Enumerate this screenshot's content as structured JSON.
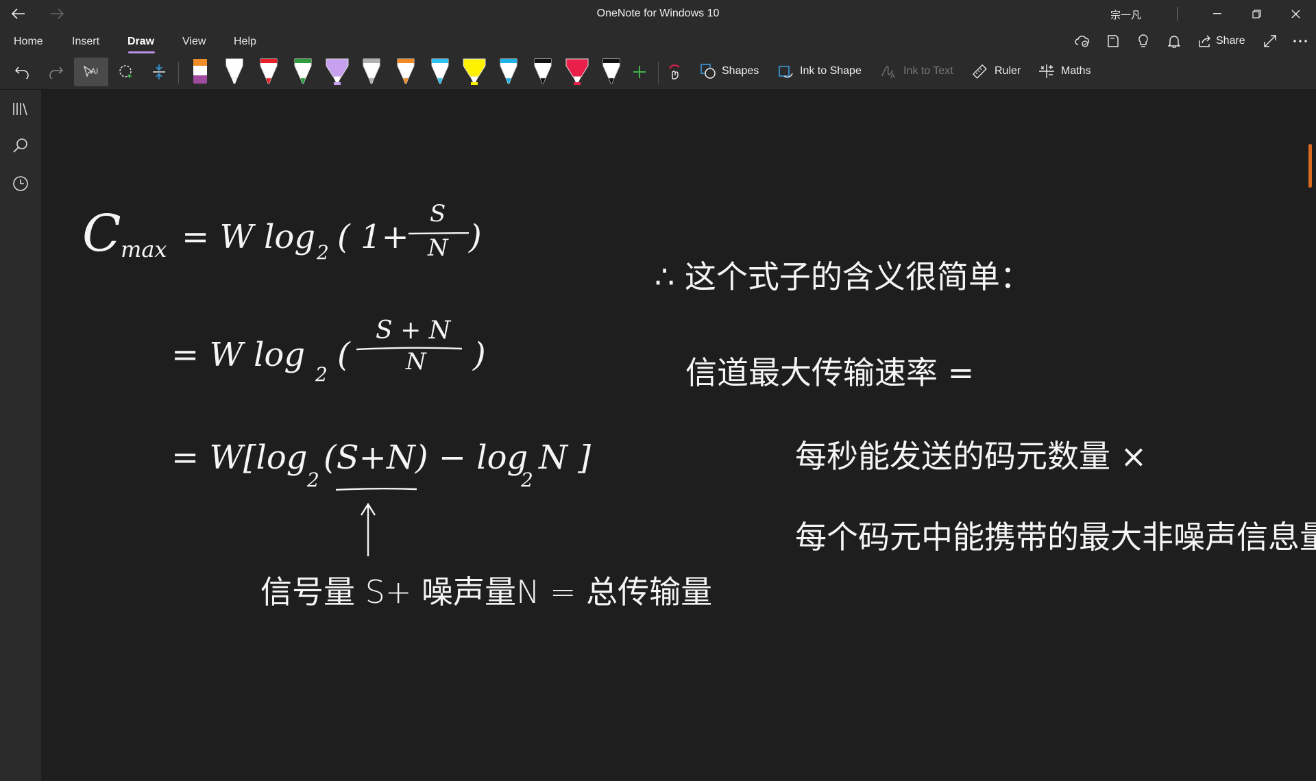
{
  "window": {
    "title": "OneNote for Windows 10",
    "user": "宗一凡"
  },
  "ribbon": {
    "tabs": [
      "Home",
      "Insert",
      "Draw",
      "View",
      "Help"
    ],
    "active_tab": "Draw",
    "share_label": "Share"
  },
  "toolbar": {
    "shapes_label": "Shapes",
    "ink_to_shape_label": "Ink to Shape",
    "ink_to_text_label": "Ink to Text",
    "ruler_label": "Ruler",
    "maths_label": "Maths",
    "pens": [
      {
        "type": "marker",
        "color": "#f28c28",
        "body": "#a04aa0"
      },
      {
        "type": "pen",
        "color": "#ffffff"
      },
      {
        "type": "pen",
        "color": "#e8202a"
      },
      {
        "type": "pen",
        "color": "#2e9d3e"
      },
      {
        "type": "highlighter",
        "color": "#c8a0f0"
      },
      {
        "type": "pen",
        "color": "#b0b0b0"
      },
      {
        "type": "pen",
        "color": "#f08a24"
      },
      {
        "type": "pen",
        "color": "#2ec0f0"
      },
      {
        "type": "highlighter",
        "color": "#fff200"
      },
      {
        "type": "pen",
        "color": "#1eb4e6"
      },
      {
        "type": "pen",
        "color": "#111111"
      },
      {
        "type": "highlighter",
        "color": "#e8204a"
      },
      {
        "type": "pen",
        "color": "#111111"
      }
    ],
    "accent_green": "#3cb44b"
  },
  "canvas": {
    "ink": {
      "line1_lhs": "C",
      "line1_sub": "max",
      "line1_eq": "= W log",
      "line1_sub2": "2",
      "line1_rest": "( 1+",
      "frac1_num": "S",
      "frac1_den": "N",
      "line1_close": ")",
      "line2_eq": "= W log",
      "line2_sub": "2",
      "line2_open": "(",
      "frac2_num": "S + N",
      "frac2_den": "N",
      "line2_close": ")",
      "line3_eq": "= W[log",
      "line3_sub": "2",
      "line3_mid": "(S+N) − log",
      "line3_sub2": "2",
      "line3_end": "N ]",
      "arrow_note": "信号量 S+ 噪声量N = 总传输量",
      "right_1": "∴ 这个式子的含义很简单：",
      "right_2": "信道最大传输速率 =",
      "right_3": "每秒能发送的码元数量 ×",
      "right_4": "每个码元中能携带的最大非噪声信息量"
    }
  }
}
